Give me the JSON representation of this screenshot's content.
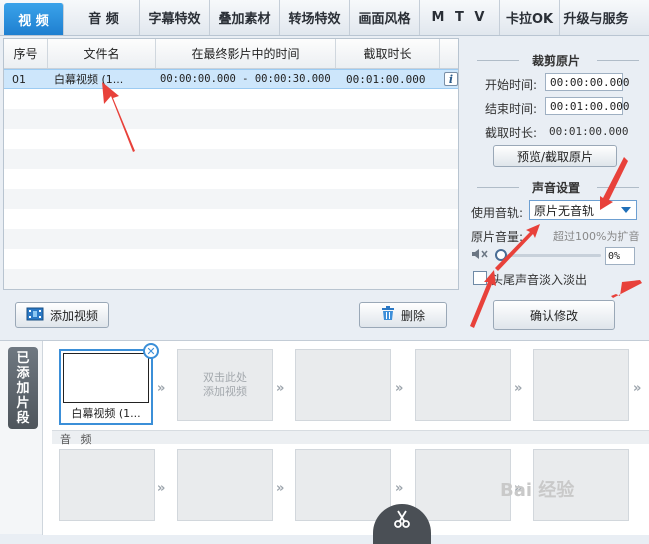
{
  "tabs": [
    "视 频",
    "音 频",
    "字幕特效",
    "叠加素材",
    "转场特效",
    "画面风格",
    "M T V",
    "卡拉OK",
    "升级与服务"
  ],
  "list": {
    "headers": [
      "序号",
      "文件名",
      "在最终影片中的时间",
      "截取时长"
    ],
    "rows": [
      {
        "index": "01",
        "file": "白幕视频 (1...",
        "timeline": "00:00:00.000 - 00:00:30.000",
        "duration": "00:01:00.000"
      }
    ],
    "add_button": "添加视频",
    "delete_button": "删除"
  },
  "trim": {
    "title": "裁剪原片",
    "start_label": "开始时间:",
    "start_value": "00:00:00.000",
    "end_label": "结束时间:",
    "end_value": "00:01:00.000",
    "duration_label": "截取时长:",
    "duration_value": "00:01:00.000",
    "preview_button": "预览/截取原片"
  },
  "sound": {
    "title": "声音设置",
    "track_label": "使用音轨:",
    "track_value": "原片无音轨",
    "volume_label": "原片音量:",
    "volume_hint": "超过100%为扩音",
    "volume_value": "0%",
    "volume_level": 0,
    "fade_label": "头尾声音淡入淡出",
    "confirm_button": "确认修改"
  },
  "timeline": {
    "side_label": [
      "已",
      "添",
      "加",
      "片",
      "段"
    ],
    "clip_name": "白幕视频 (1...",
    "add_hint_1": "双击此处",
    "add_hint_2": "添加视频",
    "audio_label": "音 频"
  },
  "colors": {
    "accent": "#1f7fd0",
    "selection": "#cde6fb",
    "annotation": "#e8413a"
  },
  "watermark": "Bai 经验"
}
